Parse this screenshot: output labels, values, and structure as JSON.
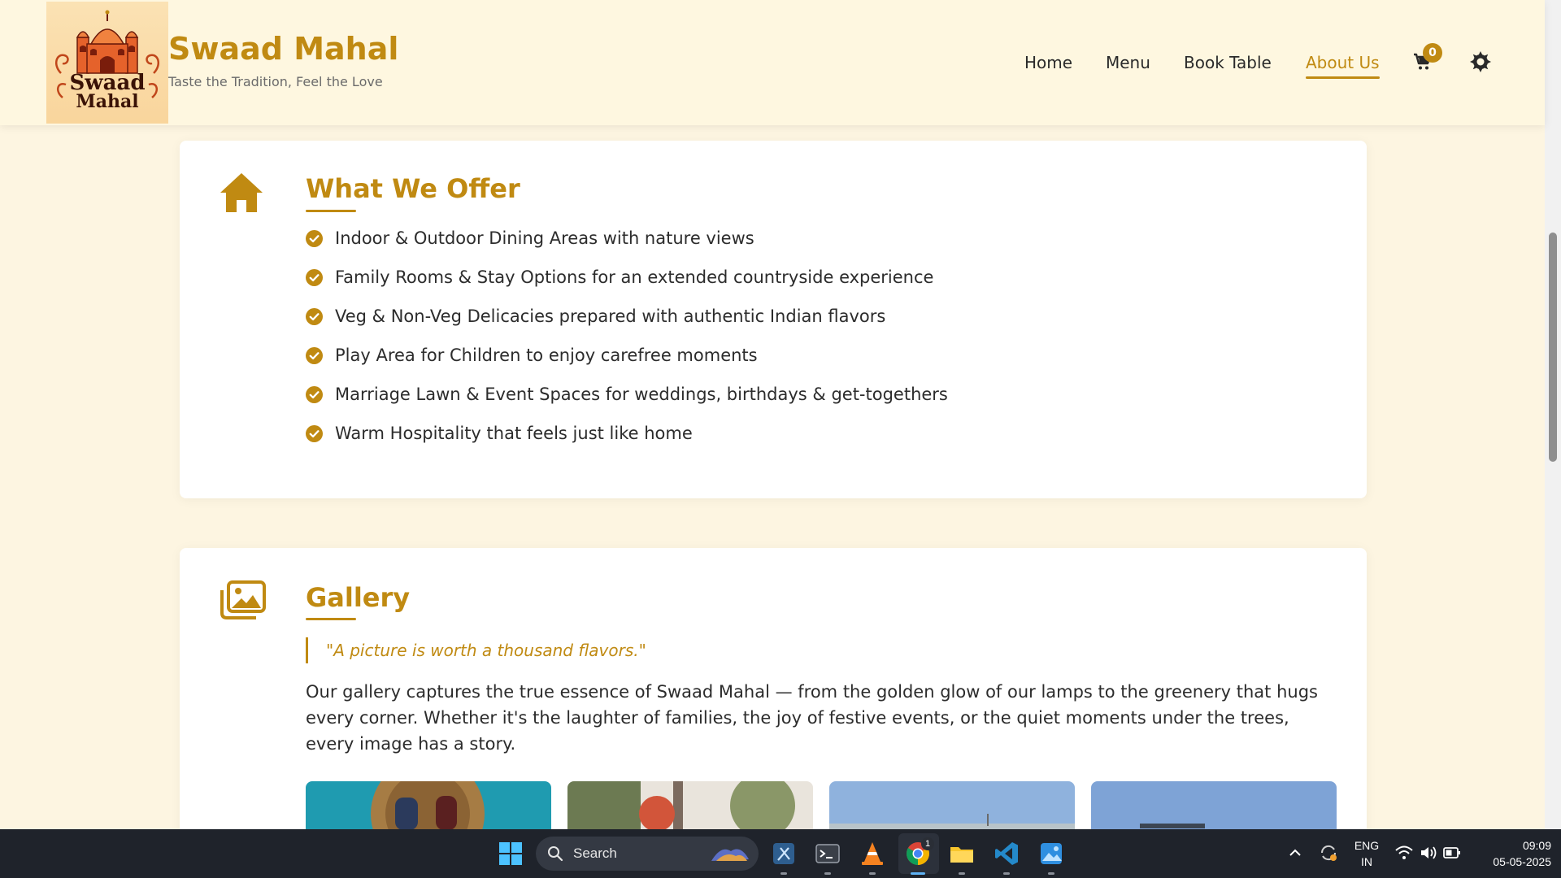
{
  "brand": {
    "name": "Swaad Mahal",
    "tagline": "Taste the Tradition, Feel the Love",
    "logo_text_top": "Swaad",
    "logo_text_bottom": "Mahal",
    "accent_color": "#c08a12",
    "logo_primary": "#e5622b",
    "logo_secondary": "#8b1f0f"
  },
  "nav": {
    "items": [
      {
        "label": "Home",
        "active": false
      },
      {
        "label": "Menu",
        "active": false
      },
      {
        "label": "Book Table",
        "active": false
      },
      {
        "label": "About Us",
        "active": true
      }
    ],
    "cart_count": "0",
    "cart_icon": "shopping-cart-icon",
    "theme_icon": "sun-icon"
  },
  "offer": {
    "title": "What We Offer",
    "icon": "home-icon",
    "items": [
      "Indoor & Outdoor Dining Areas with nature views",
      "Family Rooms & Stay Options for an extended countryside experience",
      "Veg & Non-Veg Delicacies prepared with authentic Indian flavors",
      "Play Area for Children to enjoy carefree moments",
      "Marriage Lawn & Event Spaces for weddings, birthdays & get-togethers",
      "Warm Hospitality that feels just like home"
    ]
  },
  "gallery": {
    "title": "Gallery",
    "icon": "images-icon",
    "quote": "\"A picture is worth a thousand flavors.\"",
    "description": "Our gallery captures the true essence of Swaad Mahal — from the golden glow of our lamps to the greenery that hugs every corner. Whether it's the laughter of families, the joy of festive events, or the quiet moments under the trees, every image has a story."
  },
  "taskbar": {
    "search_label": "Search",
    "apps": [
      "windows-start-icon",
      "snipping-tool-icon",
      "terminal-icon",
      "vlc-icon",
      "chrome-icon",
      "file-explorer-icon",
      "vscode-icon",
      "photos-icon"
    ],
    "chrome_badge": "1",
    "language_line1": "ENG",
    "language_line2": "IN",
    "time": "09:09",
    "date": "05-05-2025"
  }
}
